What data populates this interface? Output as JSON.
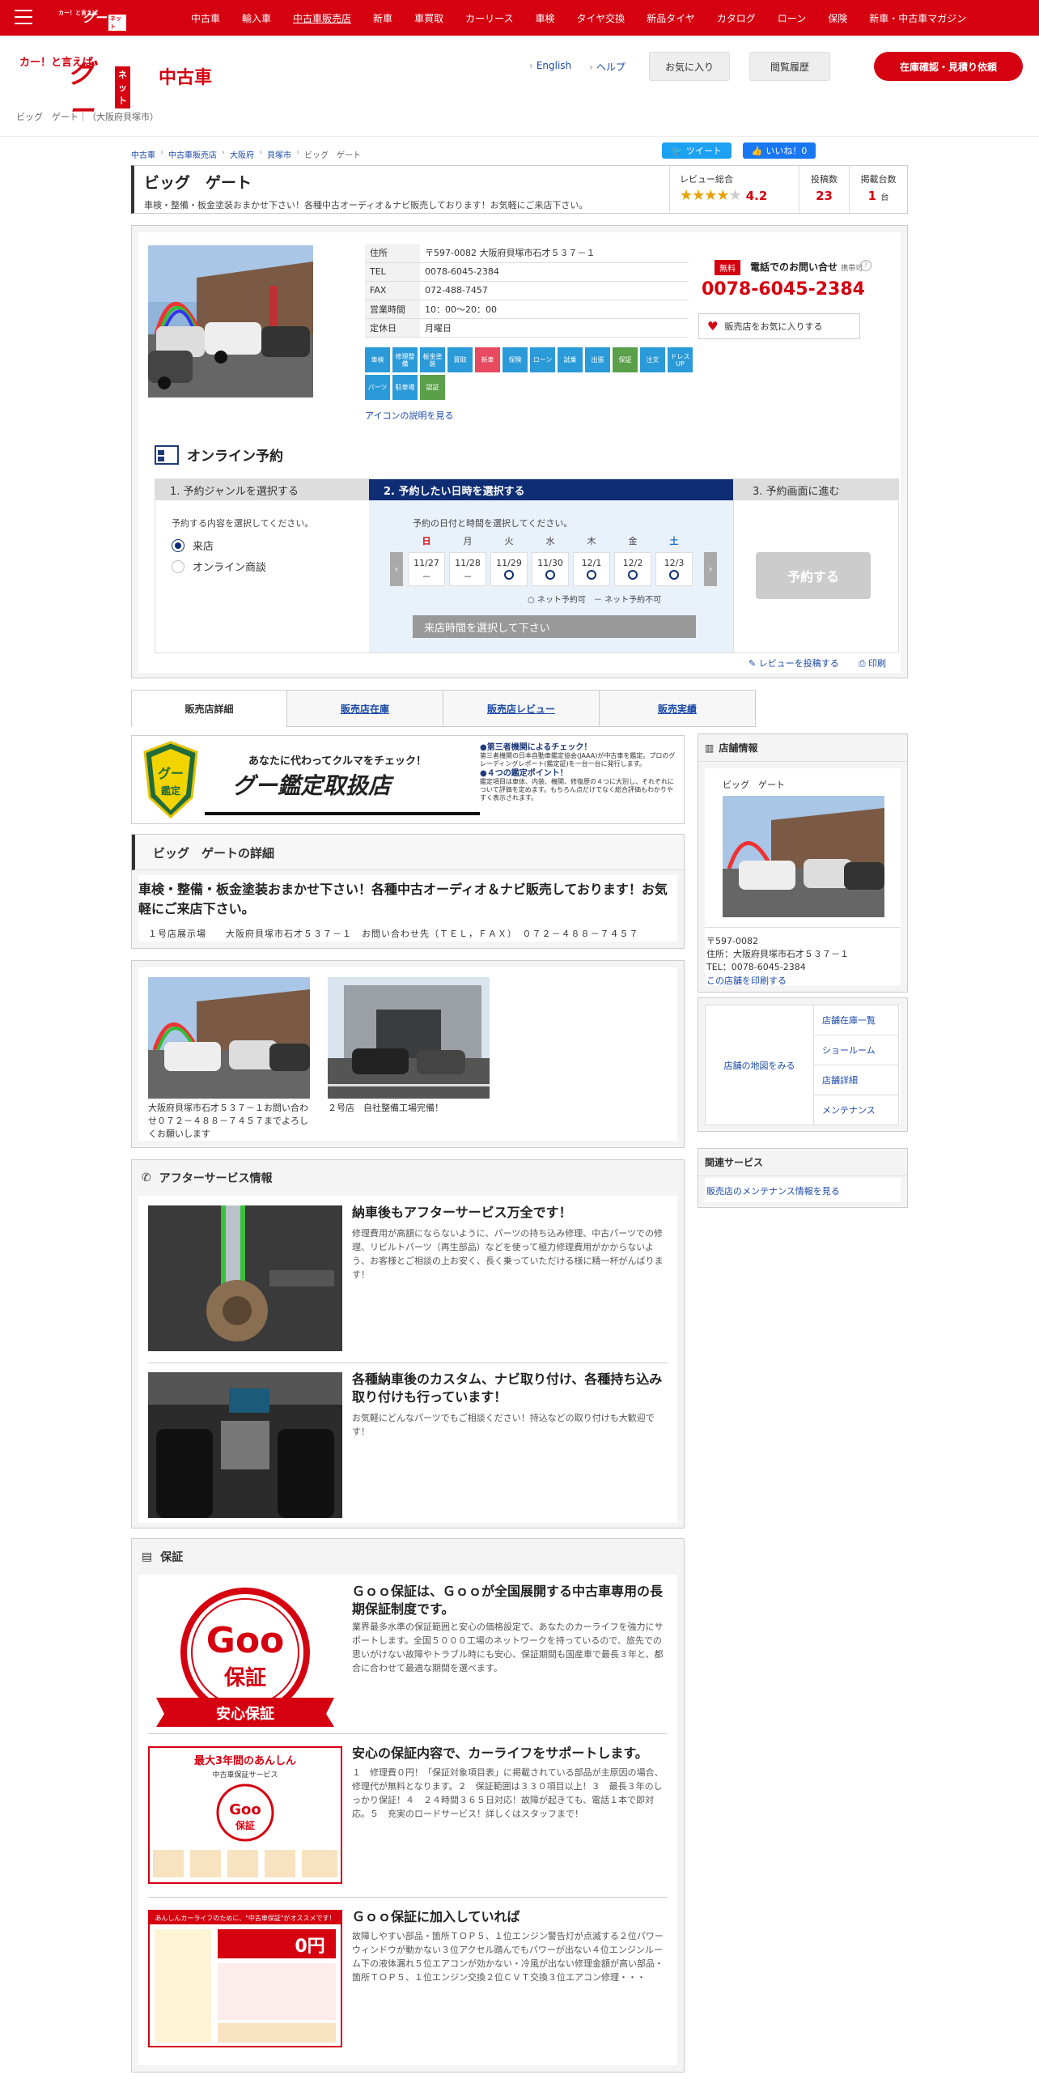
{
  "topbar": {
    "logo_small": "カー！と言えば",
    "logo_goo": "グー",
    "logo_net": "ネット",
    "nav": [
      "中古車",
      "輸入車",
      "中古車販売店",
      "新車",
      "車買取",
      "カーリース",
      "車検",
      "タイヤ交換",
      "新品タイヤ",
      "カタログ",
      "ローン",
      "保険",
      "新車・中古車マガジン"
    ],
    "active_nav": "中古車販売店"
  },
  "header": {
    "logo_tagline": "カー！と言えば",
    "logo_goo": "グー",
    "logo_net": "ネット",
    "logo_used": "中古車",
    "english": "English",
    "help": "ヘルプ",
    "favorites": "お気に入り",
    "history": "閲覧履歴",
    "stock_button": "在庫確認・見積り依頼",
    "shop_path": "ビッグ　ゲート｜（大阪府貝塚市）"
  },
  "breadcrumb": [
    "中古車",
    "中古車販売店",
    "大阪府",
    "貝塚市",
    "ビッグ　ゲート"
  ],
  "social": {
    "tweet": "ツイート",
    "like": "いいね！0"
  },
  "shop": {
    "name": "ビッグ　ゲート",
    "catch": "車検・整備・板金塗装おまかせ下さい！各種中古オーディオ＆ナビ販売しております！お気軽にご来店下さい。",
    "review_label": "レビュー総合",
    "rating": 4.2,
    "rating_text": "4.2",
    "posts_label": "投稿数",
    "posts": "23",
    "listed_label": "掲載台数",
    "listed": "1",
    "listed_unit": "台"
  },
  "info": {
    "rows": [
      {
        "k": "住所",
        "v": "〒597-0082 大阪府貝塚市石才５３７－１"
      },
      {
        "k": "TEL",
        "v": "0078-6045-2384"
      },
      {
        "k": "FAX",
        "v": "072-488-7457"
      },
      {
        "k": "営業時間",
        "v": "10：00～20：00"
      },
      {
        "k": "定休日",
        "v": "月曜日"
      }
    ],
    "icons": [
      {
        "label": "車検",
        "color": "#2b9ad8"
      },
      {
        "label": "修理整備",
        "color": "#2b9ad8"
      },
      {
        "label": "板金塗装",
        "color": "#2b9ad8"
      },
      {
        "label": "買取",
        "color": "#2b9ad8"
      },
      {
        "label": "新車",
        "color": "#e84a5f"
      },
      {
        "label": "保険",
        "color": "#2b9ad8"
      },
      {
        "label": "ローン",
        "color": "#2b9ad8"
      },
      {
        "label": "試乗",
        "color": "#2b9ad8"
      },
      {
        "label": "出張",
        "color": "#2b9ad8"
      },
      {
        "label": "保証",
        "color": "#5aa04a"
      },
      {
        "label": "注文",
        "color": "#2b9ad8"
      },
      {
        "label": "ドレスUP",
        "color": "#2b9ad8"
      },
      {
        "label": "パーツ",
        "color": "#2b9ad8"
      },
      {
        "label": "駐車場",
        "color": "#2b9ad8"
      },
      {
        "label": "認証",
        "color": "#5aa04a"
      }
    ],
    "icon_link": "アイコンの説明を見る",
    "free_label": "無料",
    "tel_label": "電話でのお問い合せ",
    "tel_mobile": "携帯可",
    "tel_number": "0078-6045-2384",
    "fav_button": "販売店をお気に入りする"
  },
  "reservation": {
    "title": "オンライン予約",
    "step1": "1. 予約ジャンルを選択する",
    "step2": "2. 予約したい日時を選択する",
    "step3": "3. 予約画面に進む",
    "step1_q": "予約する内容を選択してください。",
    "options": [
      "来店",
      "オンライン商談"
    ],
    "selected_option": "来店",
    "step2_q": "予約の日付と時間を選択してください。",
    "dow": [
      "日",
      "月",
      "火",
      "水",
      "木",
      "金",
      "土"
    ],
    "days": [
      {
        "date": "11/27",
        "mark": "－"
      },
      {
        "date": "11/28",
        "mark": "－"
      },
      {
        "date": "11/29",
        "mark": "○"
      },
      {
        "date": "11/30",
        "mark": "○"
      },
      {
        "date": "12/1",
        "mark": "○"
      },
      {
        "date": "12/2",
        "mark": "○"
      },
      {
        "date": "12/3",
        "mark": "○"
      }
    ],
    "legend": "○ ネット予約可　－ ネット予約不可",
    "time_select": "来店時間を選択して下さい",
    "reserve_button": "予約する",
    "review_link": "レビューを投稿する",
    "print_link": "印刷"
  },
  "tabs": [
    "販売店詳細",
    "販売店在庫",
    "販売店レビュー",
    "販売実績"
  ],
  "active_tab": "販売店詳細",
  "banner": {
    "badge_goo": "グー",
    "badge_label": "鑑定",
    "line1": "あなたに代わってクルマをチェック！",
    "line2": "グー鑑定取扱店",
    "p1_title": "●第三者機関によるチェック！",
    "p1_text": "第三者機関の日本自動車鑑定協会(JAAA)が中古車を鑑定。プロのグレーディングレポート(鑑定証)を一台一台に発行します。",
    "p2_title": "●４つの鑑定ポイント！",
    "p2_text": "鑑定項目は車体、内装、機関、修復歴の４つに大別し、それぞれについて評価を定めます。もちろん点だけでなく総合評価もわかりやすく表示されます。"
  },
  "detail": {
    "title": "ビッグ　ゲートの詳細",
    "catch": "車検・整備・板金塗装おまかせ下さい！各種中古オーディオ＆ナビ販売しております！お気軽にご来店下さい。",
    "note": "１号店展示場　　大阪府貝塚市石才５３７－１　お問い合わせ先（ＴＥＬ，ＦＡＸ）　０７２－４８８－７４５７"
  },
  "gallery": [
    {
      "caption": "大阪府貝塚市石才５３７－１お問い合わせ０７２－４８８－７４５７までよろしくお願いします"
    },
    {
      "caption": "２号店　自社整備工場完備！"
    }
  ],
  "after_service": {
    "title": "アフターサービス情報",
    "items": [
      {
        "title": "納車後もアフターサービス万全です！",
        "text": "修理費用が高額にならないように、パーツの持ち込み修理、中古パーツでの修理、リビルトパーツ（再生部品）などを使って極力修理費用がかからないよう、お客様とご相談の上お安く、長く乗っていただける様に精一杯がんばります！"
      },
      {
        "title": "各種納車後のカスタム、ナビ取り付け、各種持ち込み取り付けも行っています！",
        "text": "お気軽にどんなパーツでもご相談ください！持込などの取り付けも大歓迎です！"
      }
    ]
  },
  "warranty": {
    "title": "保証",
    "items": [
      {
        "title": "Ｇｏｏ保証は、Ｇｏｏが全国展開する中古車専用の長期保証制度です。",
        "text": "業界最多水準の保証範囲と安心の価格設定で、あなたのカーライフを強力にサポートします。全国５０００工場のネットワークを持っているので、旅先での思いがけない故障やトラブル時にも安心、保証期間も国産車で最長３年と、都合に合わせて最適な期間を選べます。"
      },
      {
        "title": "安心の保証内容で、カーライフをサポートします。",
        "text": "１　修理費０円！「保証対象項目表」に掲載されている部品が主原因の場合、修理代が無料となります。２　保証範囲は３３０項目以上！３　最長３年のしっかり保証！４　２４時間３６５日対応！故障が起きても、電話１本で即対応。５　充実のロードサービス！詳しくはスタッフまで！"
      },
      {
        "title": "Ｇｏｏ保証に加入していれば",
        "text": "故障しやすい部品・箇所ＴＯＰ５、１位エンジン警告灯が点滅する２位パワーウィンドウが動かない３位アクセル踏んでもパワーが出ない４位エンジンルーム下の液体漏れ５位エアコンが効かない・冷風が出ない修理金額が高い部品・箇所ＴＯＰ５、１位エンジン交換２位ＣＶＴ交換３位エアコン修理・・・"
      }
    ],
    "logo_goo": "Goo",
    "logo_hosho": "保証",
    "logo_ribbon": "安心保証",
    "ad1_top": "最大3年間のあんしん",
    "ad1_sub": "中古車保証サービス",
    "ad2_top": "あんしんカーライフのために、\"中古車保証\"がオススメです！",
    "ad2_zero": "0円"
  },
  "sidebar": {
    "store_title": "店舗情報",
    "store_name": "ビッグ　ゲート",
    "zip": "〒597-0082",
    "address": "住所：大阪府貝塚市石才５３７－１",
    "tel": "TEL：0078-6045-2384",
    "print_link": "この店舗を印刷する",
    "map_link": "店舗の地図をみる",
    "links": [
      "店舗在庫一覧",
      "ショールーム",
      "店舗詳細",
      "メンテナンス"
    ],
    "related_title": "関連サービス",
    "related_link": "販売店のメンテナンス情報を見る"
  },
  "colors": {
    "brand_red": "#d50010",
    "navy": "#0e2d74",
    "link": "#1a49a8",
    "star": "#e8a000"
  }
}
